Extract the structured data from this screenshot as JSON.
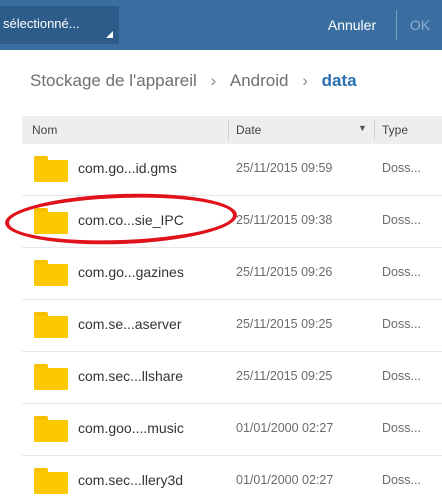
{
  "topbar": {
    "selection_label": "sélectionné...",
    "cancel_label": "Annuler",
    "ok_label": "OK",
    "accent_color": "#3a6ea0"
  },
  "breadcrumb": {
    "items": [
      "Stockage de l'appareil",
      "Android",
      "data"
    ],
    "separator": "›"
  },
  "table": {
    "columns": {
      "name": "Nom",
      "date": "Date",
      "sort_indicator": "▼",
      "type": "Type"
    },
    "rows": [
      {
        "name": "com.go...id.gms",
        "date": "25/11/2015 09:59",
        "type": "Doss..."
      },
      {
        "name": "com.co...sie_IPC",
        "date": "25/11/2015 09:38",
        "type": "Doss...",
        "highlighted": true
      },
      {
        "name": "com.go...gazines",
        "date": "25/11/2015 09:26",
        "type": "Doss..."
      },
      {
        "name": "com.se...aserver",
        "date": "25/11/2015 09:25",
        "type": "Doss..."
      },
      {
        "name": "com.sec...llshare",
        "date": "25/11/2015 09:25",
        "type": "Doss..."
      },
      {
        "name": "com.goo....music",
        "date": "01/01/2000 02:27",
        "type": "Doss..."
      },
      {
        "name": "com.sec...llery3d",
        "date": "01/01/2000 02:27",
        "type": "Doss..."
      }
    ]
  },
  "icons": {
    "folder": "folder-icon",
    "dropdown": "dropdown-triangle-icon"
  },
  "annotation_color": "#e0121c",
  "folder_color": "#fcc900"
}
